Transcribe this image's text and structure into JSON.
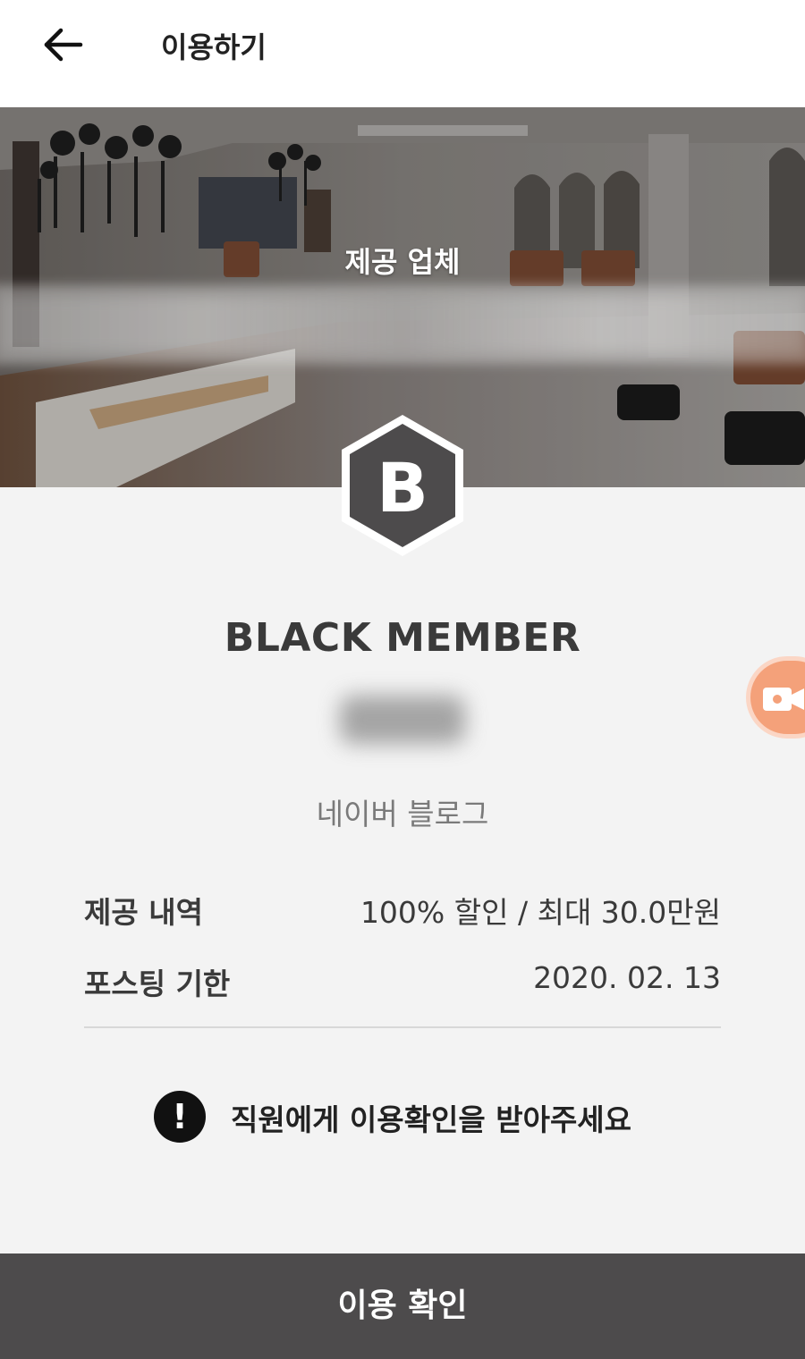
{
  "header": {
    "title": "이용하기",
    "back_icon": "arrow-left-icon"
  },
  "hero": {
    "provider_label": "제공 업체"
  },
  "member": {
    "badge_letter": "B",
    "level": "BLACK MEMBER",
    "channel": "네이버 블로그"
  },
  "details": {
    "offer_label": "제공 내역",
    "offer_value": "100% 할인 / 최대 30.0만원",
    "deadline_label": "포스팅 기한",
    "deadline_value": "2020. 02. 13"
  },
  "notice": {
    "icon": "!",
    "text": "직원에게 이용확인을 받아주세요"
  },
  "floating": {
    "icon": "video-camera-icon",
    "color": "#f4a17a"
  },
  "footer": {
    "confirm_label": "이용 확인",
    "color": "#4d4b4c"
  }
}
